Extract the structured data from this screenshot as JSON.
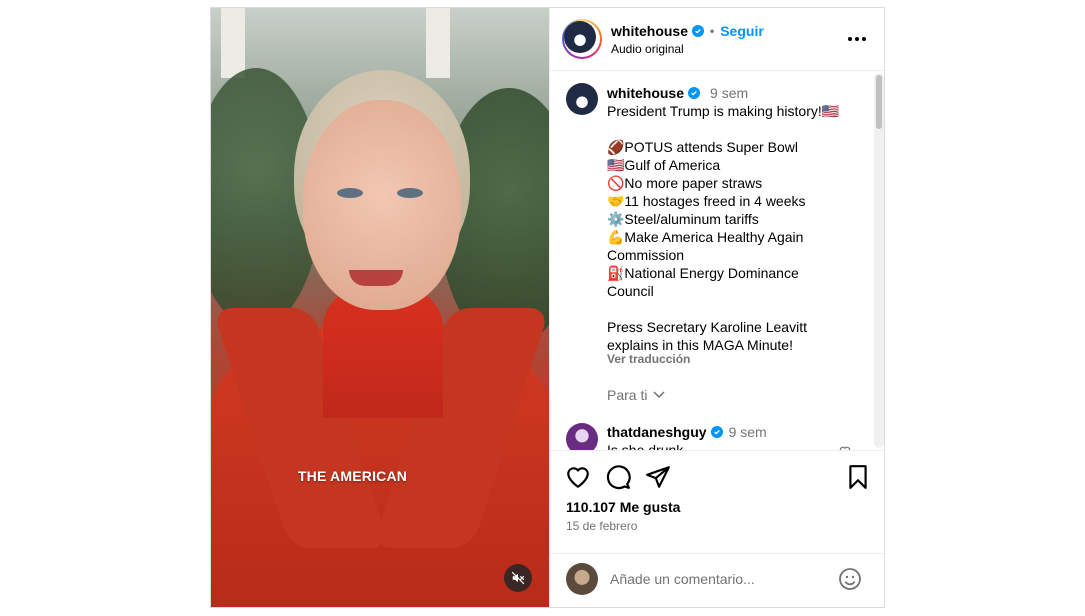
{
  "video": {
    "caption": "THE AMERICAN",
    "mute_icon": "speaker-muted-icon"
  },
  "header": {
    "username": "whitehouse",
    "follow_label": "Seguir",
    "audio": "Audio original",
    "more_icon": "more-options-icon"
  },
  "caption": {
    "username": "whitehouse",
    "time": "9 sem",
    "lines": [
      "President Trump is making history!🇺🇸",
      "",
      "🏈POTUS attends Super Bowl",
      "🇺🇸Gulf of America",
      "🚫No more paper straws",
      "🤝11 hostages freed in 4 weeks",
      "⚙️Steel/aluminum tariffs",
      "💪Make America Healthy Again",
      "Commission",
      "⛽National Energy Dominance",
      "Council",
      "",
      "Press Secretary Karoline Leavitt",
      "explains in this MAGA Minute!"
    ],
    "translate_label": "Ver traducción",
    "for_you_label": "Para ti"
  },
  "comment": {
    "username": "thatdaneshguy",
    "time": "9 sem",
    "text": "Is she drunk"
  },
  "actions": {
    "likes": "110.107 Me gusta",
    "date": "15 de febrero"
  },
  "add_comment": {
    "placeholder": "Añade un comentario..."
  },
  "colors": {
    "accent": "#0095f6",
    "muted_text": "#737373",
    "border": "#dbdbdb"
  }
}
